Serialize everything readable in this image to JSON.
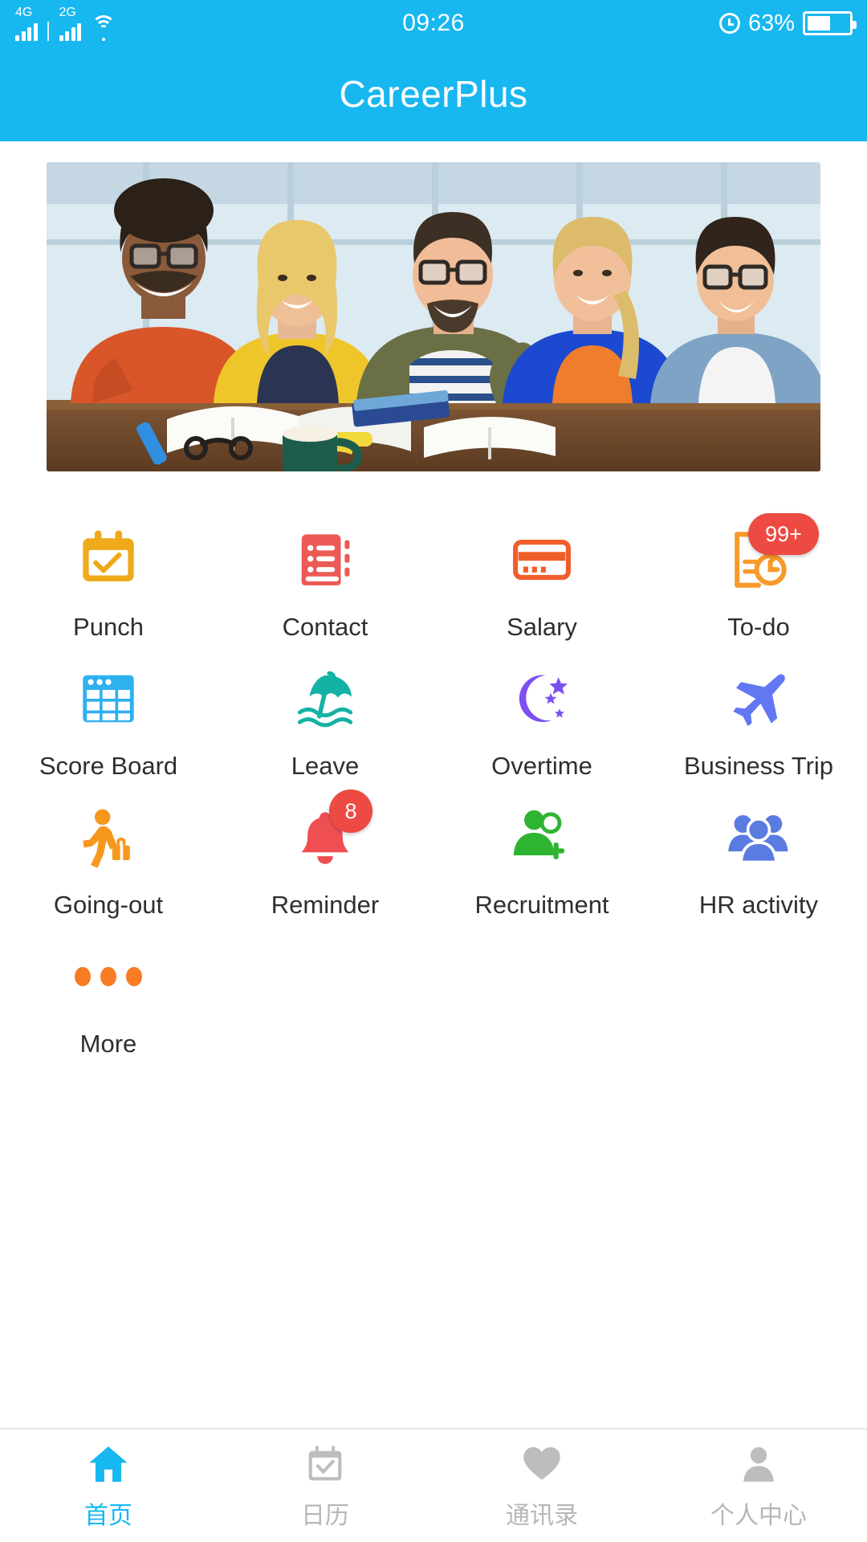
{
  "statusbar": {
    "network_primary": "4G",
    "network_secondary": "2G",
    "wifi_icon": "wifi-icon",
    "time": "09:26",
    "alarm_icon": "alarm-icon",
    "battery_percent": "63%",
    "battery_icon": "battery-icon"
  },
  "appbar": {
    "title": "CareerPlus"
  },
  "banner": {
    "name": "hero-banner-image",
    "alt": "Five smiling young people sitting at a wooden table with open books, notebooks, a green coffee mug and eyeglasses in a bright office"
  },
  "grid": {
    "items": [
      {
        "label": "Punch",
        "icon": "calendar-check-icon",
        "color": "#eeaa1a",
        "badge": null
      },
      {
        "label": "Contact",
        "icon": "address-book-icon",
        "color": "#ec5a56",
        "badge": null
      },
      {
        "label": "Salary",
        "icon": "credit-card-icon",
        "color": "#ef5f2a",
        "badge": null
      },
      {
        "label": "To-do",
        "icon": "document-clock-icon",
        "color": "#f79a2b",
        "badge": "99+"
      },
      {
        "label": "Score Board",
        "icon": "spreadsheet-icon",
        "color": "#2fb0ef",
        "badge": null
      },
      {
        "label": "Leave",
        "icon": "beach-umbrella-icon",
        "color": "#13b2a4",
        "badge": null
      },
      {
        "label": "Overtime",
        "icon": "moon-stars-icon",
        "color": "#7d4ff0",
        "badge": null
      },
      {
        "label": "Business Trip",
        "icon": "airplane-icon",
        "color": "#6278f2",
        "badge": null
      },
      {
        "label": "Going-out",
        "icon": "walking-traveler-icon",
        "color": "#f7981d",
        "badge": null
      },
      {
        "label": "Reminder",
        "icon": "bell-icon",
        "color": "#ef4f52",
        "badge": "8"
      },
      {
        "label": "Recruitment",
        "icon": "person-add-icon",
        "color": "#2fb432",
        "badge": null
      },
      {
        "label": "HR activity",
        "icon": "people-group-icon",
        "color": "#5a7ce0",
        "badge": null
      },
      {
        "label": "More",
        "icon": "ellipsis-icon",
        "color": "#f97b24",
        "badge": null
      }
    ]
  },
  "tabbar": {
    "items": [
      {
        "label": "首页",
        "icon": "home-icon",
        "active": true
      },
      {
        "label": "日历",
        "icon": "calendar-icon",
        "active": false
      },
      {
        "label": "通讯录",
        "icon": "heart-icon",
        "active": false
      },
      {
        "label": "个人中心",
        "icon": "person-icon",
        "active": false
      }
    ]
  },
  "colors": {
    "brand": "#17b7f0",
    "badge": "#ec4a42",
    "tab_active": "#17b7f0",
    "tab_inactive": "#b7b7b7"
  }
}
